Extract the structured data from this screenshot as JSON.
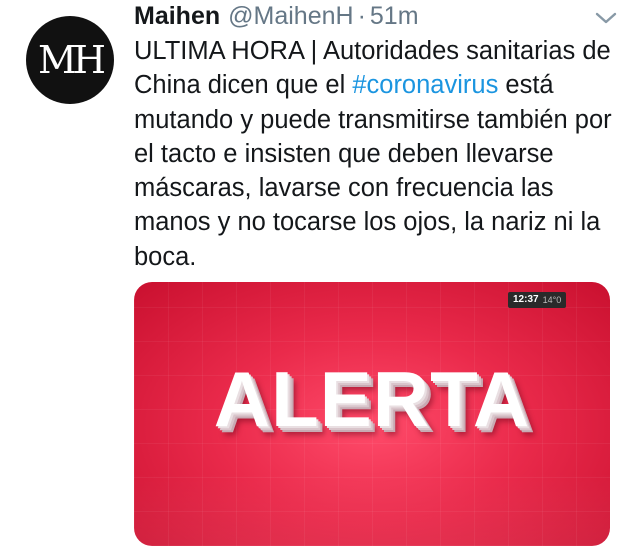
{
  "tweet": {
    "display_name": "Maihen",
    "handle": "@MaihenH",
    "separator": "·",
    "time": "51m",
    "avatar_monogram": "MH",
    "text_before_hashtag": "ULTIMA HORA | Autoridades sanitarias de China dicen que el ",
    "hashtag": "#coronavirus",
    "text_after_hashtag": " está mutando y puede transmitirse también por el tacto e insisten que deben llevarse máscaras, lavarse con frecuencia las manos y no tocarse los ojos, la nariz ni la boca."
  },
  "media": {
    "clock_time": "12:37",
    "clock_temp": "14°0",
    "headline": "ALERTA"
  },
  "colors": {
    "text": "#14171a",
    "secondary": "#657786",
    "link": "#1b95e0",
    "media_red": "#ea2a4b"
  },
  "icons": {
    "more": "chevron-down-icon"
  }
}
